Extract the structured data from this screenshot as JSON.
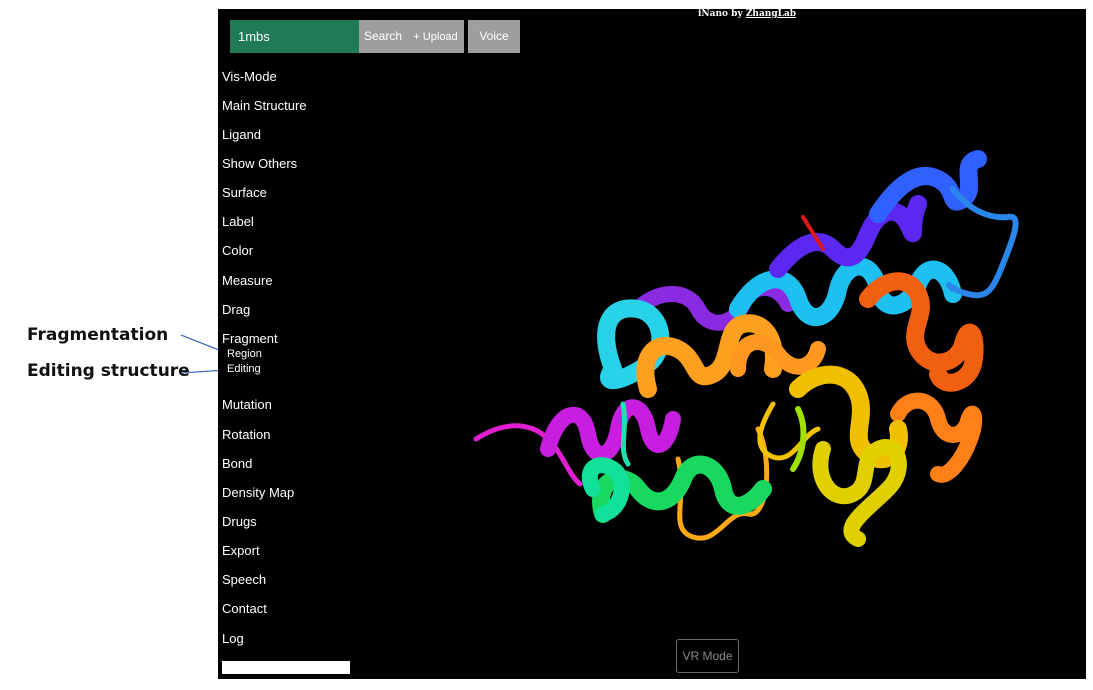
{
  "annotations": {
    "fragmentation": "Fragmentation",
    "editing_structure": "Editing structure"
  },
  "toolbar": {
    "search_value": "1mbs",
    "search_label": "Search",
    "upload_label": "+ Upload",
    "voice_label": "Voice"
  },
  "credit": {
    "prefix": "iNano by",
    "link": "ZhangLab"
  },
  "menu": {
    "items": [
      "Vis-Mode",
      "Main Structure",
      "Ligand",
      "Show Others",
      "Surface",
      "Label",
      "Color",
      "Measure",
      "Drag",
      "Fragment",
      "Mutation",
      "Rotation",
      "Bond",
      "Density Map",
      "Drugs",
      "Export",
      "Speech",
      "Contact",
      "Log"
    ],
    "fragment_sub": [
      "Region",
      "Editing"
    ]
  },
  "vr_label": "VR Mode",
  "colors": {
    "viewer_bg": "#000000",
    "search_bg": "#1f7a55",
    "button_bg": "#9e9e9e",
    "annotation_line": "#4a6fbf"
  }
}
